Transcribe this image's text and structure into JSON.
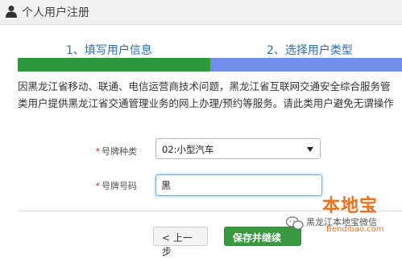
{
  "header": {
    "title": "个人用户注册",
    "icon": "user-icon"
  },
  "steps": [
    {
      "label": "1、填写用户信息"
    },
    {
      "label": "2、选择用户类型"
    }
  ],
  "progress": {
    "fraction": 0.5,
    "done_color": "#2f9a3d",
    "todo_color": "#6f8fe9"
  },
  "notice": {
    "line1": "因黑龙江省移动、联通、电信运营商技术问题，黑龙江省互联网交通安全综合服务管",
    "line2": "类用户提供黑龙江省交通管理业务的网上办理/预约等服务。请此类用户避免无谓操作"
  },
  "form": {
    "required_mark": "*",
    "plate_type_label": "号牌种类",
    "plate_type_value": "02:小型汽车",
    "plate_number_label": "号牌号码",
    "plate_number_value": "黑"
  },
  "buttons": {
    "prev": "< 上一步",
    "next": "保存并继续 >"
  },
  "watermark": {
    "brand": "本地宝",
    "account": "黑龙江本地宝微信",
    "url": "Bendibao.com"
  }
}
